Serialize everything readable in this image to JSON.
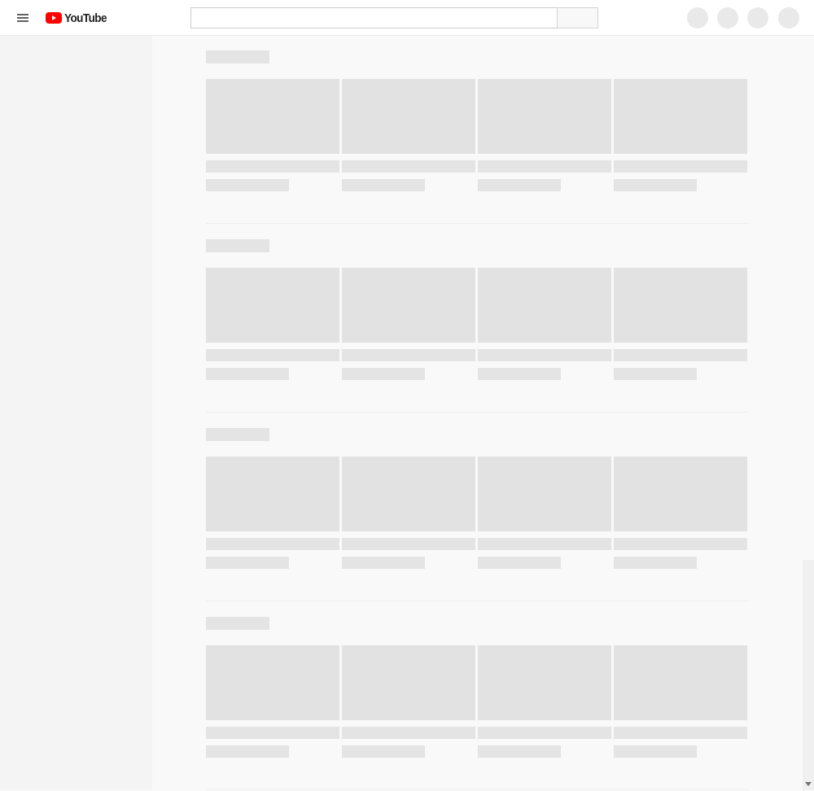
{
  "app": {
    "brand": "YouTube",
    "accent_color": "#ff0000"
  },
  "header": {
    "menu_icon": "hamburger-menu-icon",
    "search": {
      "value": "",
      "placeholder": ""
    },
    "search_button_icon": "search-icon",
    "right_icons": [
      "create-icon",
      "apps-icon",
      "notifications-icon",
      "account-avatar"
    ]
  },
  "main": {
    "state": "loading-skeleton",
    "shelves": [
      {
        "cards": 4
      },
      {
        "cards": 4
      },
      {
        "cards": 4
      },
      {
        "cards": 4
      }
    ]
  }
}
